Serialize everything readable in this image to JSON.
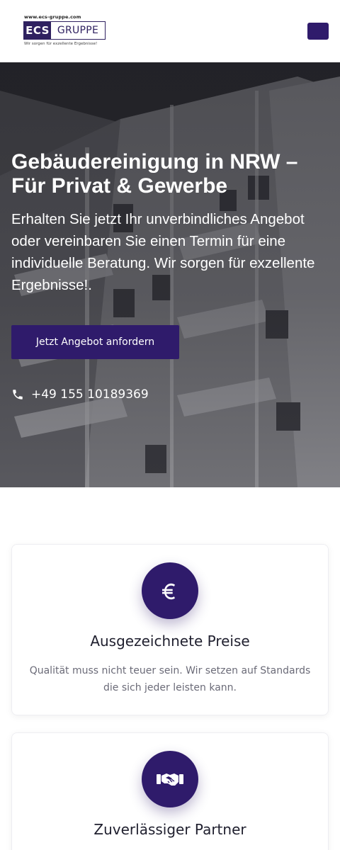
{
  "header": {
    "logo": {
      "url": "www.ecs-gruppe.com",
      "ecs": "ECS",
      "gruppe": "GRUPPE",
      "tagline": "Wir sorgen für exzellente Ergebnisse!"
    },
    "menu_icon": "menu-icon"
  },
  "hero": {
    "title": "Gebäudereinigung in NRW – Für Privat & Gewerbe",
    "text": "Erhalten Sie jetzt Ihr unverbindliches Angebot oder vereinbaren Sie einen Termin für eine individuelle Beratung. Wir sorgen für exzellente Ergebnisse!.",
    "cta_label": "Jetzt Angebot anfordern",
    "phone_icon": "phone-icon",
    "phone": "+49 155 10189369"
  },
  "features": [
    {
      "icon": "euro-icon",
      "title": "Ausgezeichnete Preise",
      "text": "Qualität muss nicht teuer sein. Wir setzen auf Standards die sich jeder leisten kann."
    },
    {
      "icon": "handshake-icon",
      "title": "Zuverlässiger Partner",
      "text": ""
    }
  ],
  "colors": {
    "brand": "#2f1b6b",
    "card_text": "#6b6b78"
  }
}
